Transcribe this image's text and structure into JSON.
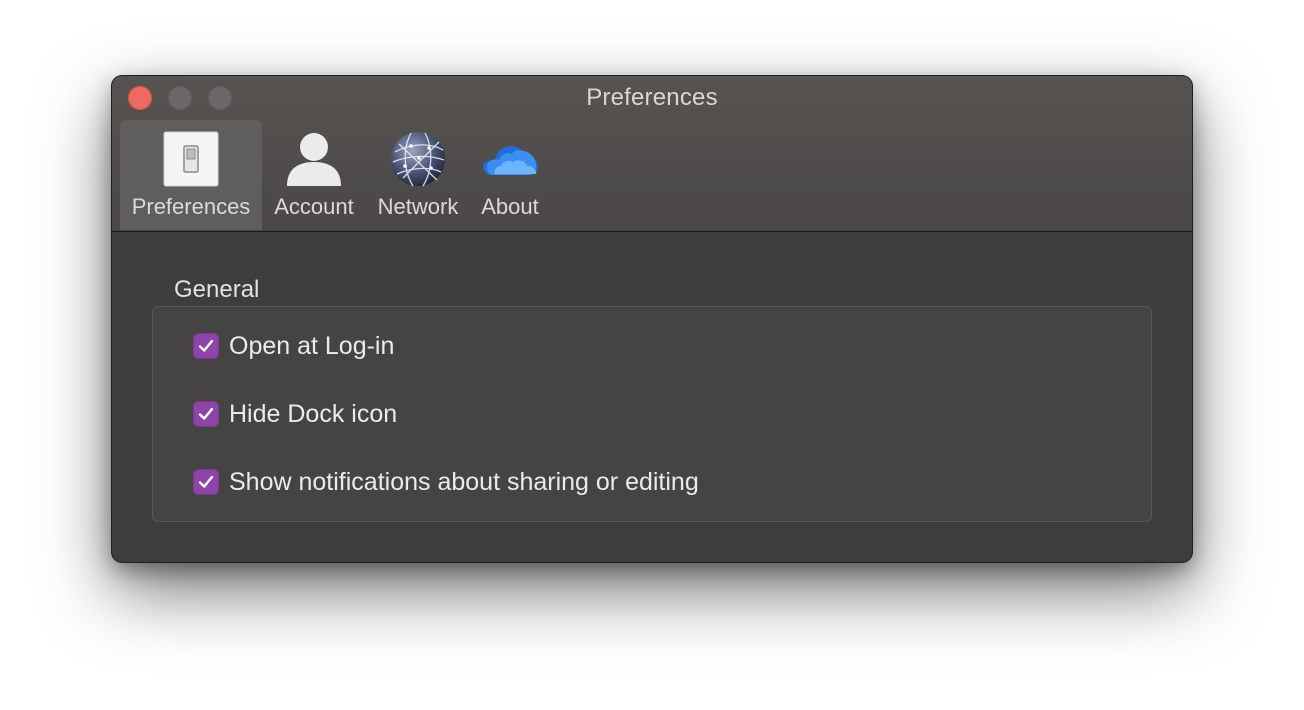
{
  "window": {
    "title": "Preferences"
  },
  "toolbar": {
    "items": [
      {
        "label": "Preferences",
        "icon": "switch-icon",
        "selected": true
      },
      {
        "label": "Account",
        "icon": "person-icon",
        "selected": false
      },
      {
        "label": "Network",
        "icon": "globe-network-icon",
        "selected": false
      },
      {
        "label": "About",
        "icon": "onedrive-cloud-icon",
        "selected": false
      }
    ]
  },
  "general": {
    "title": "General",
    "options": [
      {
        "label": "Open at Log-in",
        "checked": true
      },
      {
        "label": "Hide Dock icon",
        "checked": true
      },
      {
        "label": "Show notifications about sharing or editing",
        "checked": true
      }
    ]
  },
  "colors": {
    "window_background": "#3f3d3c",
    "titlebar": "#565351",
    "checkbox_accent": "#8e44a8",
    "close_button": "#ed6a5e"
  }
}
